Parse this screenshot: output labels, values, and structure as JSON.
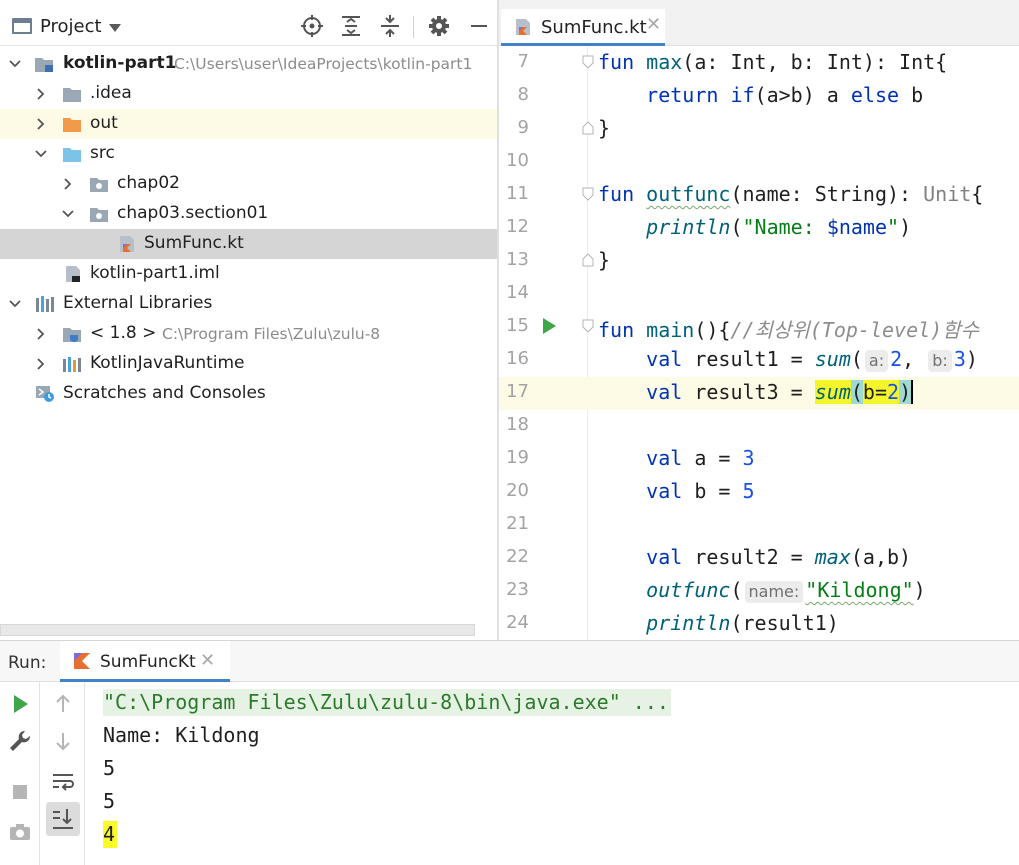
{
  "project": {
    "title": "Project",
    "tree": [
      {
        "label": "kotlin-part1",
        "path": "C:\\Users\\user\\IdeaProjects\\kotlin-part1"
      },
      {
        "label": ".idea"
      },
      {
        "label": "out"
      },
      {
        "label": "src"
      },
      {
        "label": "chap02"
      },
      {
        "label": "chap03.section01"
      },
      {
        "label": "SumFunc.kt"
      },
      {
        "label": "kotlin-part1.iml"
      },
      {
        "label": "External Libraries"
      },
      {
        "label": "< 1.8 >",
        "path": "C:\\Program Files\\Zulu\\zulu-8"
      },
      {
        "label": "KotlinJavaRuntime"
      },
      {
        "label": "Scratches and Consoles"
      }
    ]
  },
  "editor": {
    "tab_label": "SumFunc.kt",
    "line_numbers": [
      "7",
      "8",
      "9",
      "10",
      "11",
      "12",
      "13",
      "14",
      "15",
      "16",
      "17",
      "18",
      "19",
      "20",
      "21",
      "22",
      "23",
      "24"
    ],
    "code": {
      "l7": {
        "kw": "fun",
        "name": "max",
        "rest": "(a: Int, b: Int): Int{"
      },
      "l8": {
        "kw1": "return",
        "kw2": "if",
        "mid": "(a>b) a ",
        "kw3": "else",
        "end": " b"
      },
      "l9": "}",
      "l11": {
        "kw": "fun",
        "name": "outfunc",
        "rest1": "(name: String): ",
        "unit": "Unit",
        "rest2": "{"
      },
      "l12": {
        "fn": "println",
        "open": "(",
        "str1": "\"Name: ",
        "tmpl": "$name",
        "str2": "\"",
        "close": ")"
      },
      "l13": "}",
      "l15": {
        "kw": "fun",
        "name": "main",
        "rest": "(){",
        "comment": "//최상위(Top-level)함수"
      },
      "l16": {
        "kw": "val",
        "var": " result1 = ",
        "fn": "sum",
        "p1": "(",
        "hint_a": "a:",
        "v1": "2",
        "comma": ", ",
        "hint_b": "b:",
        "v2": "3",
        "close": ")"
      },
      "l17": {
        "kw": "val",
        "var": " result3 = ",
        "fn": "sum",
        "open": "(",
        "arg": "b=",
        "v": "2",
        "close": ")"
      },
      "l19": {
        "kw": "val",
        "var": " a = ",
        "v": "3"
      },
      "l20": {
        "kw": "val",
        "var": " b = ",
        "v": "5"
      },
      "l22": {
        "kw": "val",
        "var": " result2 = ",
        "fn": "max",
        "rest": "(a,b)"
      },
      "l23": {
        "fn": "outfunc",
        "open": "(",
        "hint": "name:",
        "str": "\"Kildong\"",
        "close": ")"
      },
      "l24": {
        "fn": "println",
        "rest": "(result1)"
      }
    }
  },
  "run": {
    "label": "Run:",
    "tab_label": "SumFuncKt",
    "console": [
      "\"C:\\Program Files\\Zulu\\zulu-8\\bin\\java.exe\" ...",
      "Name: Kildong",
      "5",
      "5",
      "4"
    ]
  },
  "colors": {
    "keyword": "#0033b3",
    "function": "#00627a",
    "string": "#067d17",
    "number": "#1750eb",
    "highlight": "#f5f52c",
    "selection": "#d5d5d5",
    "run_green": "#3fa64a"
  }
}
